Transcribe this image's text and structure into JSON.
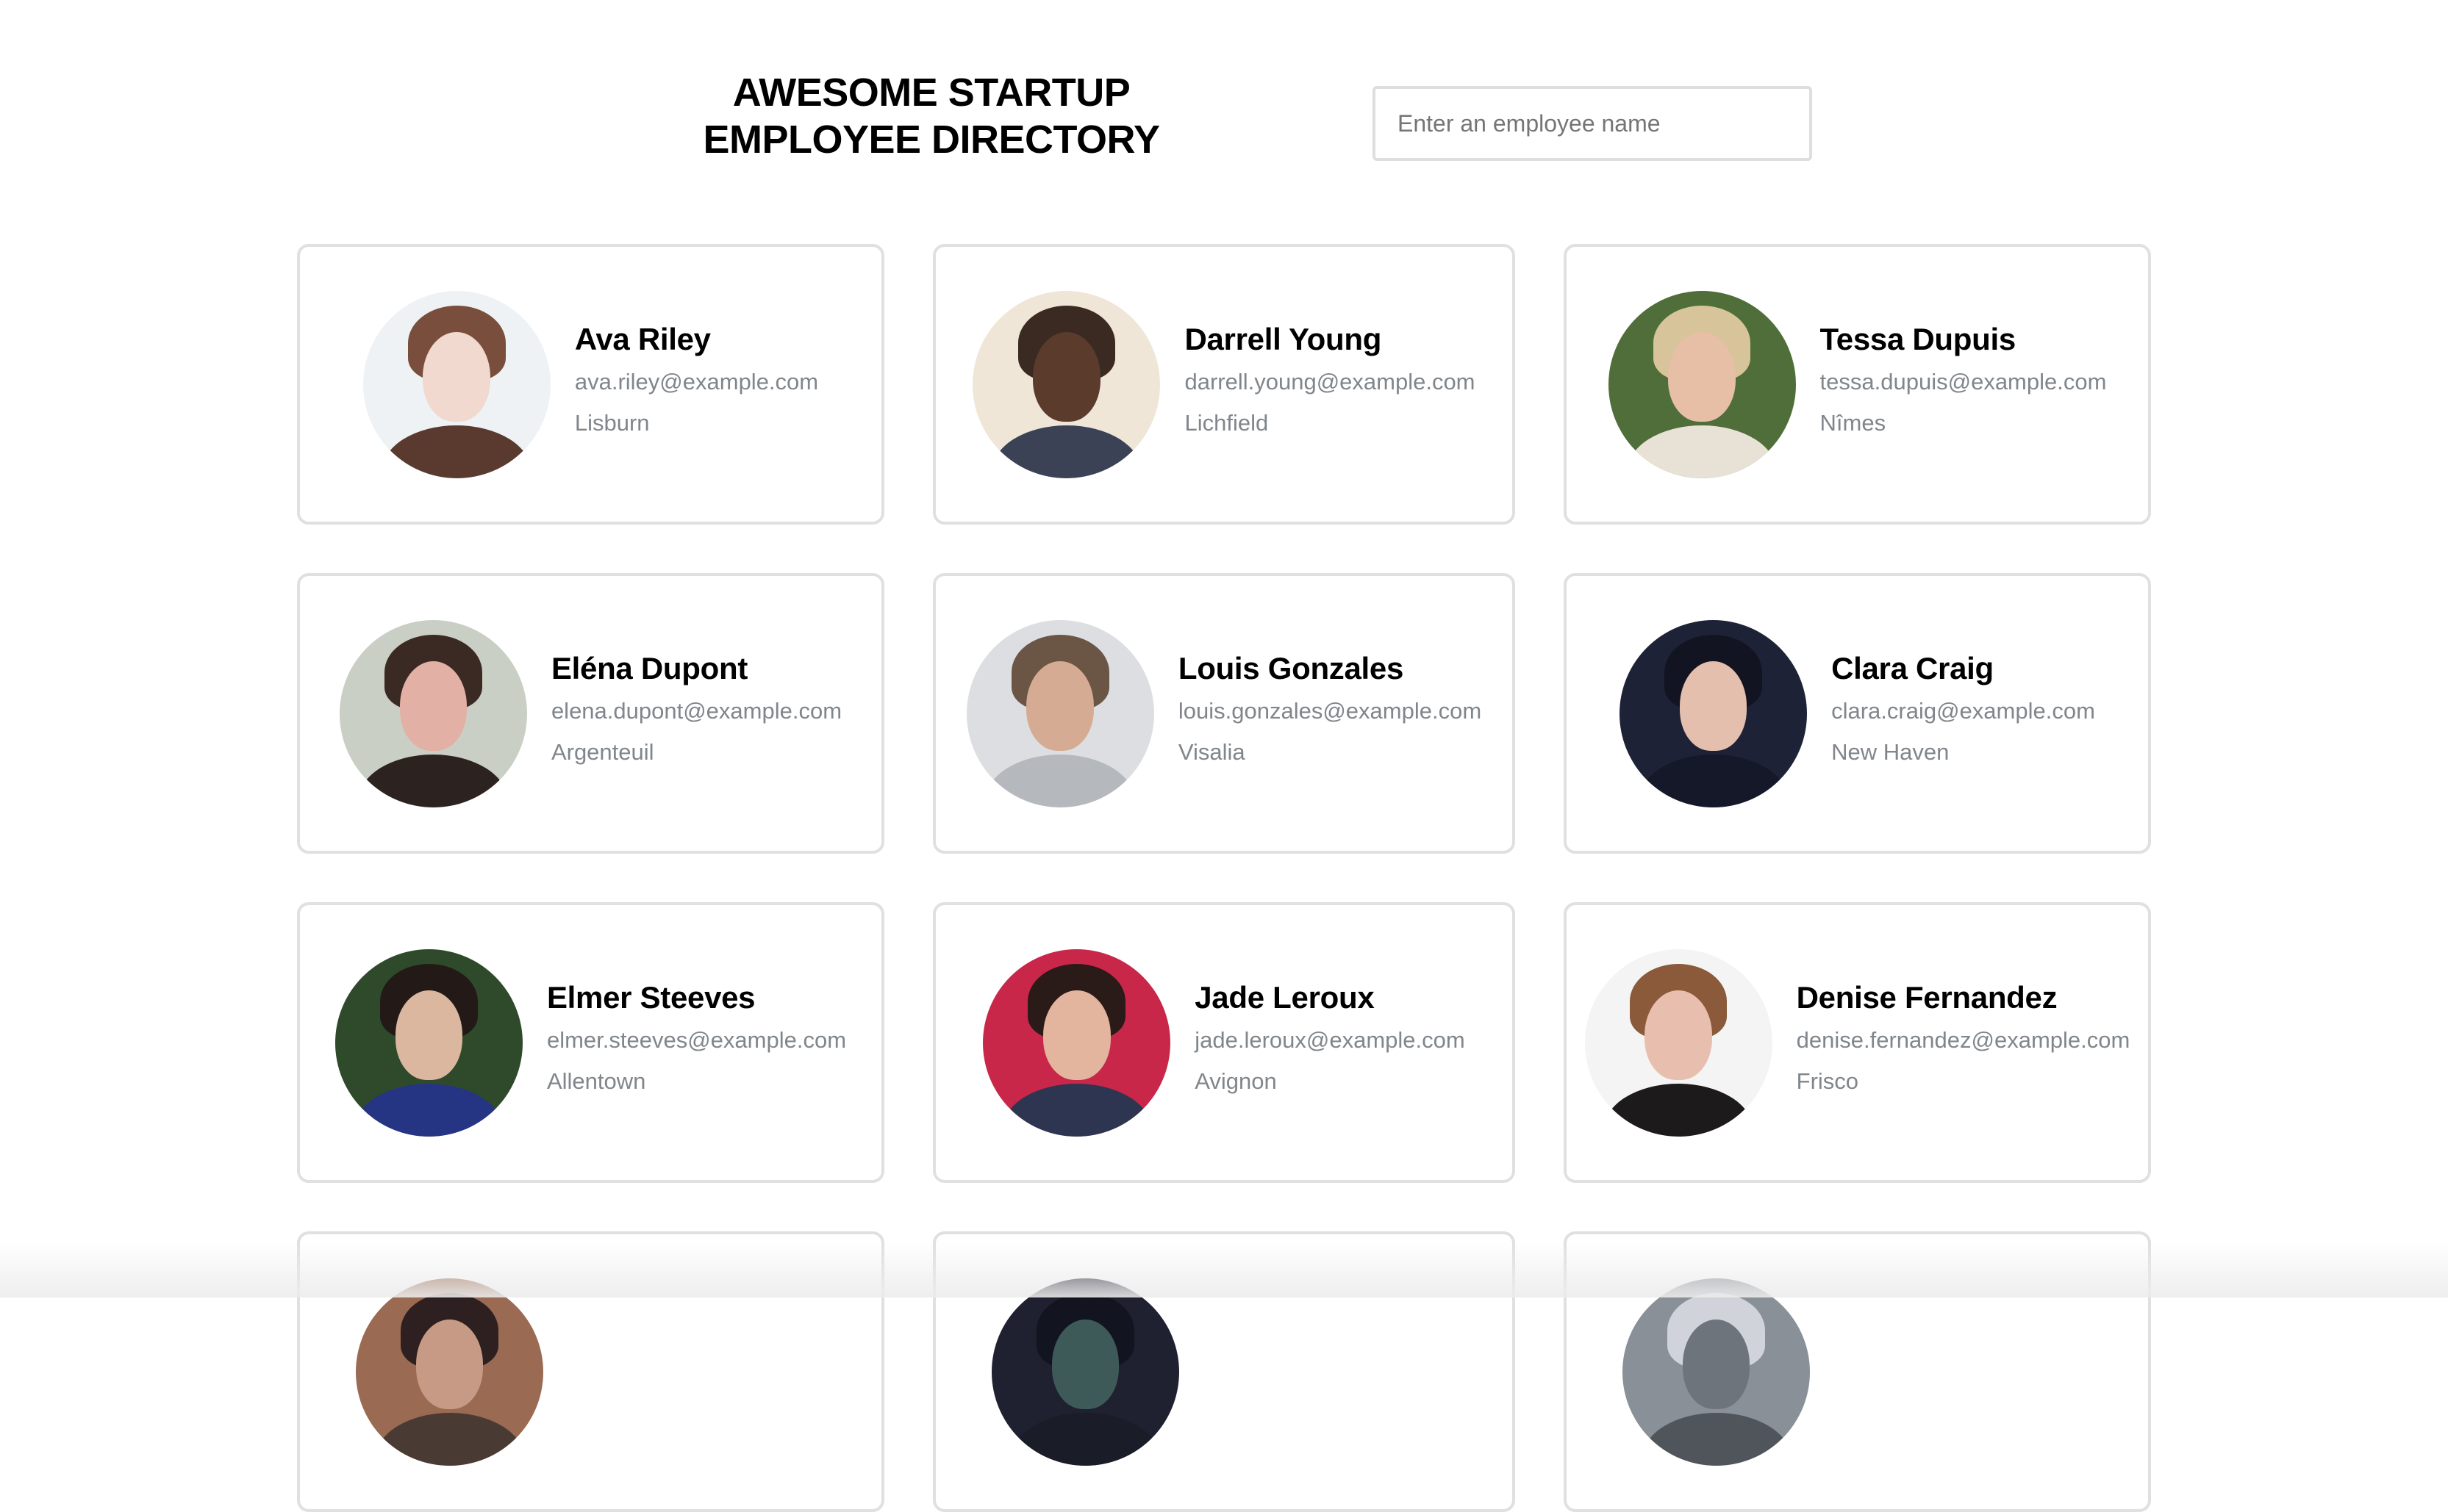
{
  "header": {
    "title_line1": "AWESOME STARTUP",
    "title_line2": "EMPLOYEE DIRECTORY",
    "search": {
      "placeholder": "Enter an employee name",
      "value": ""
    }
  },
  "employees": [
    {
      "name": "Ava Riley",
      "email": "ava.riley@example.com",
      "city": "Lisburn",
      "avatar": {
        "bg": "#eef2f5",
        "hair": "#7a4e3c",
        "skin": "#f1d9cf",
        "clothes": "#5a3a2e"
      }
    },
    {
      "name": "Darrell Young",
      "email": "darrell.young@example.com",
      "city": "Lichfield",
      "avatar": {
        "bg": "#efe6d8",
        "hair": "#3a2a22",
        "skin": "#5a3b2c",
        "clothes": "#3b4256"
      }
    },
    {
      "name": "Tessa Dupuis",
      "email": "tessa.dupuis@example.com",
      "city": "Nîmes",
      "avatar": {
        "bg": "#4f6e3a",
        "hair": "#d8c49a",
        "skin": "#e6bfa6",
        "clothes": "#e8e2d6"
      }
    },
    {
      "name": "Eléna Dupont",
      "email": "elena.dupont@example.com",
      "city": "Argenteuil",
      "avatar": {
        "bg": "#c9cfc4",
        "hair": "#3b2a24",
        "skin": "#e2b0a4",
        "clothes": "#2c2220"
      }
    },
    {
      "name": "Louis Gonzales",
      "email": "louis.gonzales@example.com",
      "city": "Visalia",
      "avatar": {
        "bg": "#dcdee2",
        "hair": "#6b5646",
        "skin": "#d6ab93",
        "clothes": "#b5b8bc"
      }
    },
    {
      "name": "Clara Craig",
      "email": "clara.craig@example.com",
      "city": "New Haven",
      "avatar": {
        "bg": "#1d2236",
        "hair": "#121521",
        "skin": "#e4bfae",
        "clothes": "#151828"
      }
    },
    {
      "name": "Elmer Steeves",
      "email": "elmer.steeves@example.com",
      "city": "Allentown",
      "avatar": {
        "bg": "#2f4a2a",
        "hair": "#231a18",
        "skin": "#dcb7a0",
        "clothes": "#263484"
      }
    },
    {
      "name": "Jade Leroux",
      "email": "jade.leroux@example.com",
      "city": "Avignon",
      "avatar": {
        "bg": "#c9274a",
        "hair": "#2a1a18",
        "skin": "#e3b49e",
        "clothes": "#2d3550"
      }
    },
    {
      "name": "Denise Fernandez",
      "email": "denise.fernandez@example.com",
      "city": "Frisco",
      "avatar": {
        "bg": "#f4f4f4",
        "hair": "#8a5a3a",
        "skin": "#e8bfae",
        "clothes": "#1c1a1a"
      }
    }
  ],
  "partial_employees": [
    {
      "avatar": {
        "bg": "#9a6a52",
        "hair": "#2e2020",
        "skin": "#c79a86",
        "clothes": "#4a3a34"
      }
    },
    {
      "avatar": {
        "bg": "#1f2030",
        "hair": "#121420",
        "skin": "#3e5a58",
        "clothes": "#1a1c28"
      }
    },
    {
      "avatar": {
        "bg": "#8a9098",
        "hair": "#d0d4da",
        "skin": "#6e747c",
        "clothes": "#50555c"
      }
    }
  ],
  "colors": {
    "card_border": "#e0e0e0",
    "secondary_text": "#80868b",
    "input_border": "#dedede"
  }
}
